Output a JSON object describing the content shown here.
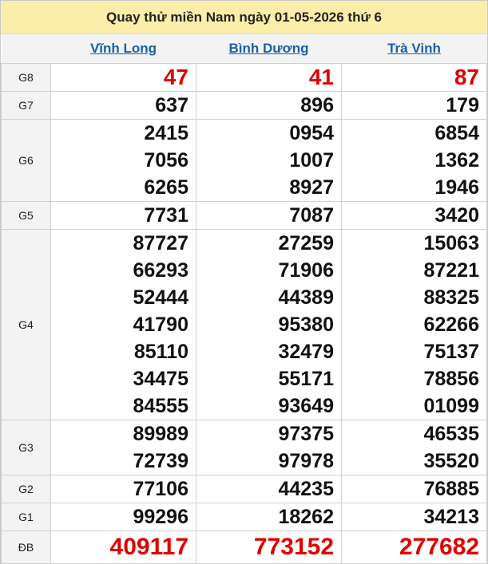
{
  "title": "Quay thử miền Nam ngày 01-05-2026 thứ 6",
  "provinces": [
    "Vĩnh Long",
    "Bình Dương",
    "Trà Vinh"
  ],
  "colors": {
    "red": "#e00000",
    "link": "#1a5fa8",
    "header_bg": "#fbeeaa"
  },
  "prizes": [
    {
      "label": "G8",
      "values": [
        [
          "47"
        ],
        [
          "41"
        ],
        [
          "87"
        ]
      ]
    },
    {
      "label": "G7",
      "values": [
        [
          "637"
        ],
        [
          "896"
        ],
        [
          "179"
        ]
      ]
    },
    {
      "label": "G6",
      "values": [
        [
          "2415",
          "7056",
          "6265"
        ],
        [
          "0954",
          "1007",
          "8927"
        ],
        [
          "6854",
          "1362",
          "1946"
        ]
      ]
    },
    {
      "label": "G5",
      "values": [
        [
          "7731"
        ],
        [
          "7087"
        ],
        [
          "3420"
        ]
      ]
    },
    {
      "label": "G4",
      "values": [
        [
          "87727",
          "66293",
          "52444",
          "41790",
          "85110",
          "34475",
          "84555"
        ],
        [
          "27259",
          "71906",
          "44389",
          "95380",
          "32479",
          "55171",
          "93649"
        ],
        [
          "15063",
          "87221",
          "88325",
          "62266",
          "75137",
          "78856",
          "01099"
        ]
      ]
    },
    {
      "label": "G3",
      "values": [
        [
          "89989",
          "72739"
        ],
        [
          "97375",
          "97978"
        ],
        [
          "46535",
          "35520"
        ]
      ]
    },
    {
      "label": "G2",
      "values": [
        [
          "77106"
        ],
        [
          "44235"
        ],
        [
          "76885"
        ]
      ]
    },
    {
      "label": "G1",
      "values": [
        [
          "99296"
        ],
        [
          "18262"
        ],
        [
          "34213"
        ]
      ]
    },
    {
      "label": "ĐB",
      "values": [
        [
          "409117"
        ],
        [
          "773152"
        ],
        [
          "277682"
        ]
      ]
    }
  ]
}
